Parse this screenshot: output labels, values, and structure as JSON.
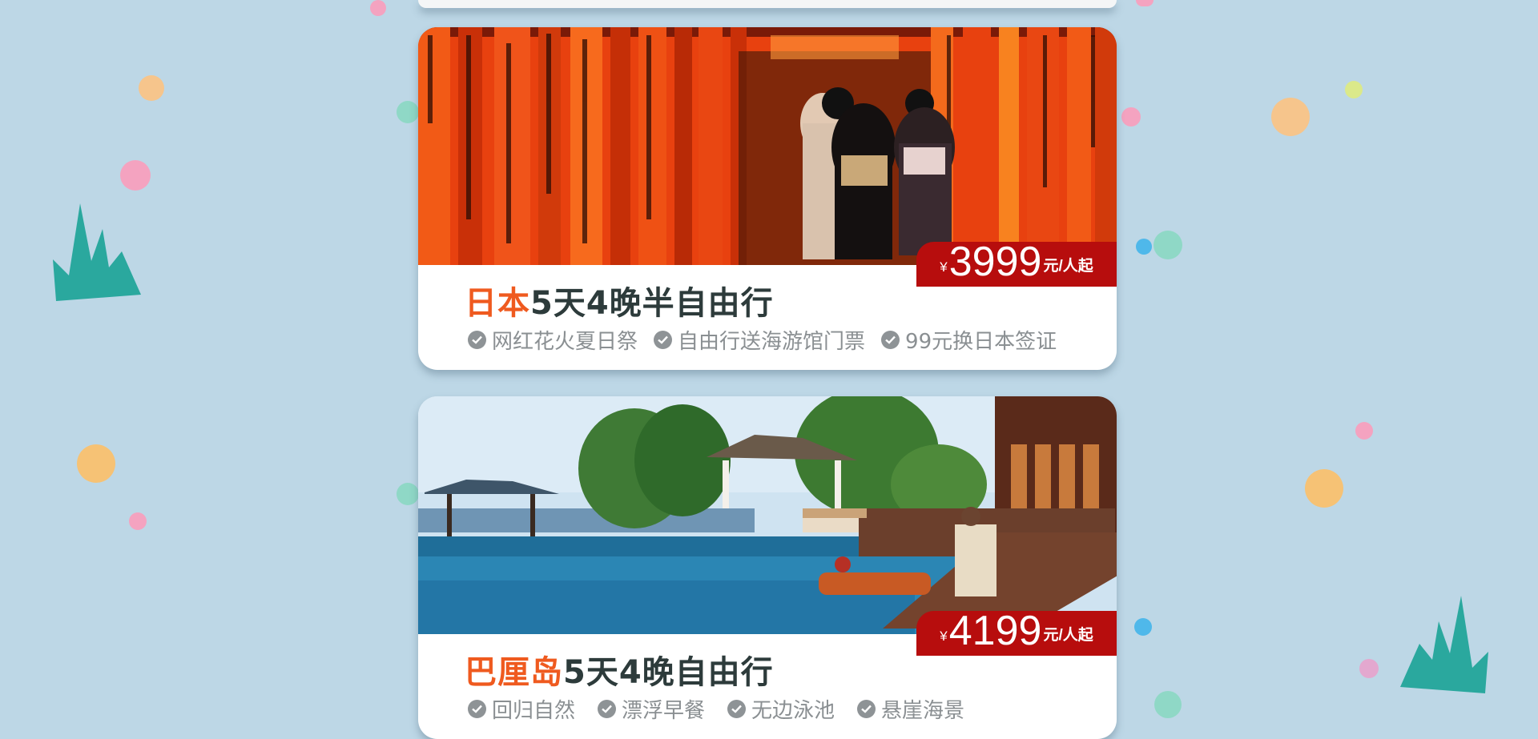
{
  "cards": [
    {
      "destination": "日本",
      "trip": "5天4晚半自由行",
      "price": {
        "currency": "¥",
        "amount": "3999",
        "unit": "元/人起"
      },
      "tags": [
        "网红花火夏日祭",
        "自由行送海游馆门票",
        "99元换日本签证"
      ]
    },
    {
      "destination": "巴厘岛",
      "trip": "5天4晚自由行",
      "price": {
        "currency": "¥",
        "amount": "4199",
        "unit": "元/人起"
      },
      "tags": [
        "回归自然",
        "漂浮早餐",
        "无边泳池",
        "悬崖海景"
      ]
    }
  ],
  "colors": {
    "background": "#bdd7e6",
    "destination_accent": "#ef5a1f",
    "price_badge": "#b70d0d",
    "title_text": "#2d3b3b",
    "tag_text": "#8a8f92"
  }
}
